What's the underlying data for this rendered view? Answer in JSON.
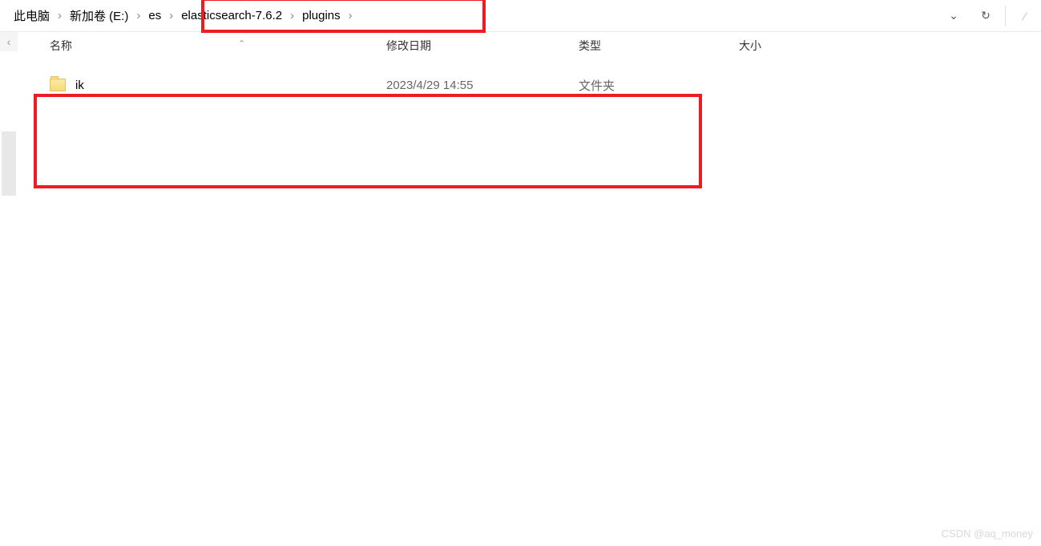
{
  "breadcrumb": {
    "items": [
      "此电脑",
      "新加卷 (E:)",
      "es",
      "elasticsearch-7.6.2",
      "plugins"
    ]
  },
  "columns": {
    "name": "名称",
    "modified": "修改日期",
    "type": "类型",
    "size": "大小"
  },
  "files": [
    {
      "name": "ik",
      "modified": "2023/4/29 14:55",
      "type": "文件夹",
      "size": ""
    }
  ],
  "watermark": "CSDN @aq_money"
}
